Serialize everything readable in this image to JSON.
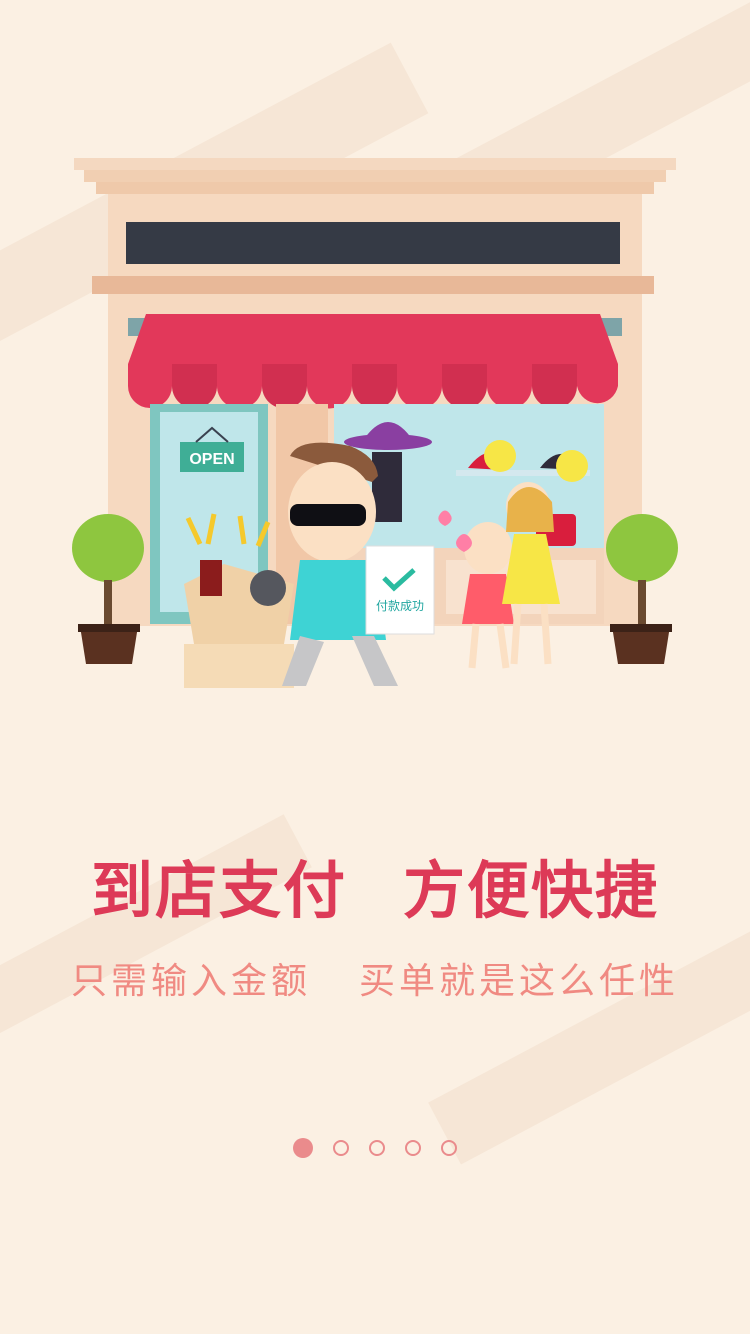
{
  "illustration": {
    "open_sign": "OPEN",
    "receipt_text": "付款成功"
  },
  "headline": {
    "part1": "到店支付",
    "part2": "方便快捷"
  },
  "subline": {
    "part1": "只需输入金额",
    "part2": "买单就是这么任性"
  },
  "pager": {
    "total": 5,
    "active_index": 0
  },
  "colors": {
    "background": "#fbf0e3",
    "headline": "#dd3a57",
    "subline": "#f08a82",
    "awning": "#e2385a",
    "dot": "#ea8b8c"
  }
}
